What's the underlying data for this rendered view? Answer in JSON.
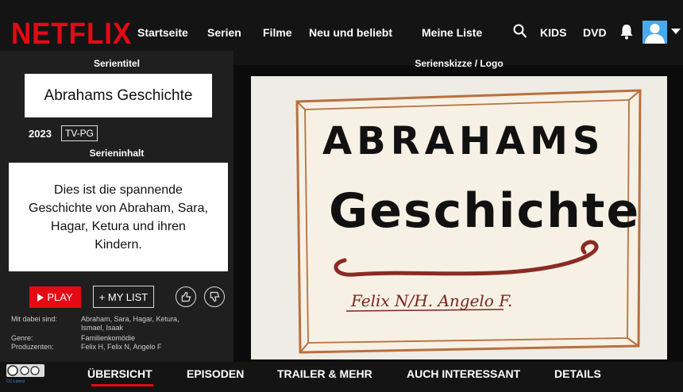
{
  "header": {
    "logo": "NETFLIX",
    "nav": [
      "Startseite",
      "Serien",
      "Filme",
      "Neu und beliebt",
      "Meine Liste"
    ],
    "kids": "KIDS",
    "dvd": "DVD",
    "icons": [
      "search-icon",
      "bell-icon",
      "avatar",
      "chevron-down-icon"
    ]
  },
  "left": {
    "series_title_heading": "Serientitel",
    "series_title": "Abrahams Geschichte",
    "year": "2023",
    "rating": "TV-PG",
    "content_heading": "Serieninhalt",
    "description": "Dies ist die spannende Geschichte von Abraham, Sara, Hagar, Ketura und ihren Kindern.",
    "play_label": "PLAY",
    "mylist_label": "+ MY LIST",
    "meta": {
      "cast_label": "Mit dabei sind:",
      "cast_line1": "Abraham, Sara, Hagar, Ketura,",
      "cast_line2": "Ismael, Isaak",
      "genre_label": "Genre:",
      "genre": "Familienkomödie",
      "producers_label": "Produzenten:",
      "producers": "Felix H, Felix N, Angelo F"
    }
  },
  "right": {
    "heading": "Serienskizze / Logo",
    "sketch_line1": "ABRAHAMS",
    "sketch_line2": "Geschichte",
    "sketch_signature": "Felix N/H.  Angelo F."
  },
  "bottom": {
    "tabs": [
      "ÜBERSICHT",
      "EPISODEN",
      "TRAILER & MEHR",
      "AUCH INTERESSANT",
      "DETAILS"
    ],
    "active_tab": "ÜBERSICHT",
    "cc_link": "CC-Lizenz"
  },
  "colors": {
    "accent": "#e50914",
    "background": "#141414",
    "panel": "#1f1f1f"
  }
}
